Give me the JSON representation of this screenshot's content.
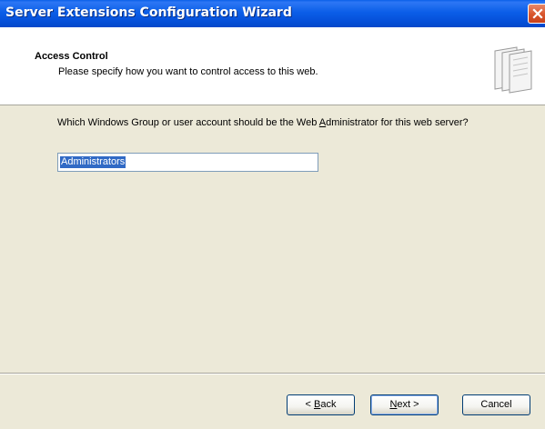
{
  "window": {
    "title": "Server Extensions Configuration Wizard"
  },
  "header": {
    "title": "Access Control",
    "subtitle": "Please specify how you want to control access to this web."
  },
  "question": {
    "part1": "Which Windows Group or user account should be the Web ",
    "mnemonic": "A",
    "part2": "dministrator for this web server?"
  },
  "admin_field": {
    "value": "Administrators"
  },
  "buttons": {
    "back": {
      "prefix": "< ",
      "mnemonic": "B",
      "rest": "ack"
    },
    "next": {
      "mnemonic": "N",
      "rest": "ext >"
    },
    "cancel": "Cancel"
  },
  "colors": {
    "titlebar": "#0b5ee8",
    "dialog_bg": "#ece9d8",
    "selection": "#316ac5"
  },
  "icons": {
    "close": "close-x-icon",
    "wizard": "wizard-pages-icon"
  }
}
